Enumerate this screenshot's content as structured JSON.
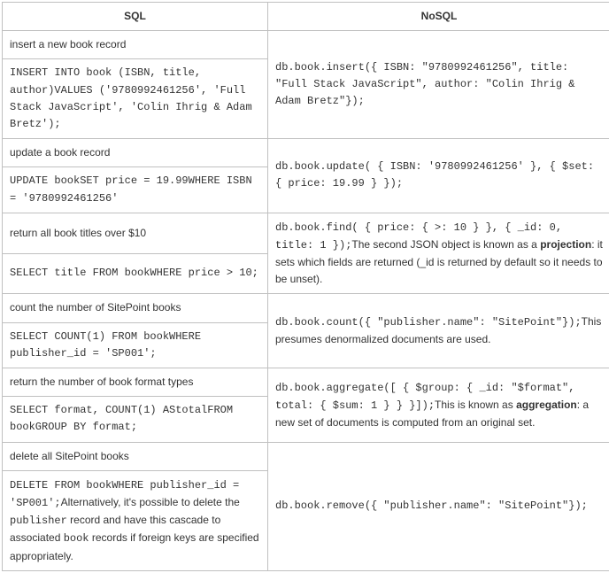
{
  "headers": {
    "sql": "SQL",
    "nosql": "NoSQL"
  },
  "rows": {
    "insert_label": "insert a new book record",
    "insert_sql": "INSERT INTO book (ISBN, title, author)VALUES ('9780992461256', 'Full Stack JavaScript', 'Colin Ihrig & Adam Bretz');",
    "insert_nosql": "db.book.insert({ ISBN: \"9780992461256\", title: \"Full Stack JavaScript\", author: \"Colin Ihrig & Adam Bretz\"});",
    "update_label": "update a book record",
    "update_sql": "UPDATE bookSET price = 19.99WHERE ISBN = '9780992461256'",
    "update_nosql": "db.book.update( { ISBN: '9780992461256' }, { $set: { price: 19.99 } });",
    "titles_label": "return all book titles over $10",
    "titles_sql": "SELECT title FROM bookWHERE price > 10;",
    "titles_nosql_code": "db.book.find( { price: { >: 10 } }, { _id: 0, title: 1 });",
    "titles_nosql_note1": "The second JSON object is known as a ",
    "titles_nosql_bold": "projection",
    "titles_nosql_note2": ": it sets which fields are returned (_id is returned by default so it needs to be unset).",
    "count_label": "count the number of SitePoint books",
    "count_sql": "SELECT COUNT(1) FROM bookWHERE publisher_id = 'SP001';",
    "count_nosql_code": "db.book.count({ \"publisher.name\": \"SitePoint\"});",
    "count_nosql_note": "This presumes denormalized documents are used.",
    "format_label": "return the number of book format types",
    "format_sql": "SELECT format, COUNT(1) AStotalFROM bookGROUP BY format;",
    "format_nosql_code": "db.book.aggregate([ { $group: { _id: \"$format\", total: { $sum: 1 } } }]);",
    "format_nosql_note1": "This is known as ",
    "format_nosql_bold": "aggregation",
    "format_nosql_note2": ": a new set of documents is computed from an original set.",
    "delete_label": "delete all SitePoint books",
    "delete_sql_code": "DELETE FROM bookWHERE publisher_id = 'SP001';",
    "delete_sql_note1": "Alternatively, it's possible to delete the ",
    "delete_sql_inline1": "publisher",
    "delete_sql_note2": " record and have this cascade to associated ",
    "delete_sql_inline2": "book",
    "delete_sql_note3": " records if foreign keys are specified appropriately.",
    "delete_nosql": "db.book.remove({ \"publisher.name\": \"SitePoint\"});"
  }
}
